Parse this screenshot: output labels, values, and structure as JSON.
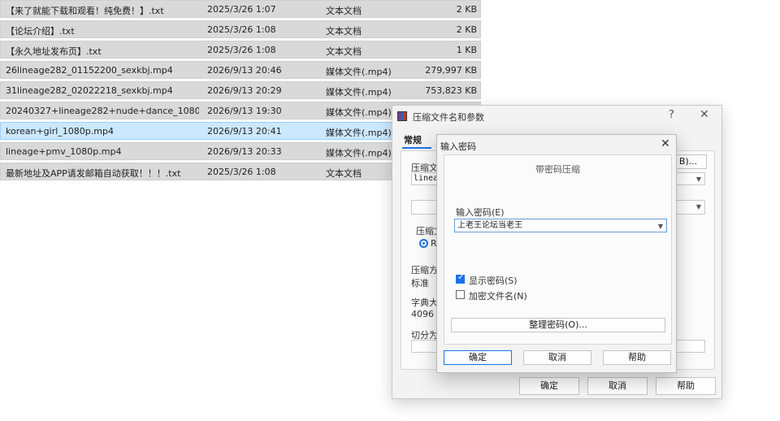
{
  "files": [
    {
      "name": "【来了就能下载和观看！纯免费！】.txt",
      "date": "2025/3/26 1:07",
      "type": "文本文档",
      "size": "2 KB",
      "selected": false
    },
    {
      "name": "【论坛介绍】.txt",
      "date": "2025/3/26 1:08",
      "type": "文本文档",
      "size": "2 KB",
      "selected": false
    },
    {
      "name": "【永久地址发布页】.txt",
      "date": "2025/3/26 1:08",
      "type": "文本文档",
      "size": "1 KB",
      "selected": false
    },
    {
      "name": "26lineage282_01152200_sexkbj.mp4",
      "date": "2026/9/13 20:46",
      "type": "媒体文件(.mp4)",
      "size": "279,997 KB",
      "selected": false
    },
    {
      "name": "31lineage282_02022218_sexkbj.mp4",
      "date": "2026/9/13 20:29",
      "type": "媒体文件(.mp4)",
      "size": "753,823 KB",
      "selected": false
    },
    {
      "name": "20240327+lineage282+nude+dance_1080p...",
      "date": "2026/9/13 19:30",
      "type": "媒体文件(.mp4)",
      "size": "",
      "selected": false
    },
    {
      "name": "korean+girl_1080p.mp4",
      "date": "2026/9/13 20:41",
      "type": "媒体文件(.mp4)",
      "size": "",
      "selected": true
    },
    {
      "name": "lineage+pmv_1080p.mp4",
      "date": "2026/9/13 20:33",
      "type": "媒体文件(.mp4)",
      "size": "",
      "selected": false
    },
    {
      "name": "最新地址及APP请发邮箱自动获取！！！.txt",
      "date": "2025/3/26 1:08",
      "type": "文本文档",
      "size": "",
      "selected": false
    }
  ],
  "main_dialog": {
    "title": "压缩文件名和参数",
    "help_glyph": "?",
    "close_glyph": "✕",
    "tab_general": "常规",
    "archive_name_label": "压缩文",
    "archive_name_value": "lineag",
    "browse_button": "B)...",
    "format_label": "压缩文",
    "format_option": "R",
    "method_label": "压缩方",
    "method_value": "标准",
    "dict_label": "字典大",
    "dict_value": "4096 K",
    "split_label": "切分为",
    "ok_button": "确定",
    "cancel_button": "取消",
    "help_button": "帮助"
  },
  "password_dialog": {
    "title": "输入密码",
    "close_glyph": "✕",
    "group_title": "带密码压缩",
    "enter_label": "输入密码(E)",
    "password_value": "上老王论坛当老王",
    "show_password_label": "显示密码(S)",
    "show_password_checked": true,
    "encrypt_names_label": "加密文件名(N)",
    "encrypt_names_checked": false,
    "organize_button": "整理密码(O)...",
    "ok_button": "确定",
    "cancel_button": "取消",
    "help_button": "帮助"
  }
}
